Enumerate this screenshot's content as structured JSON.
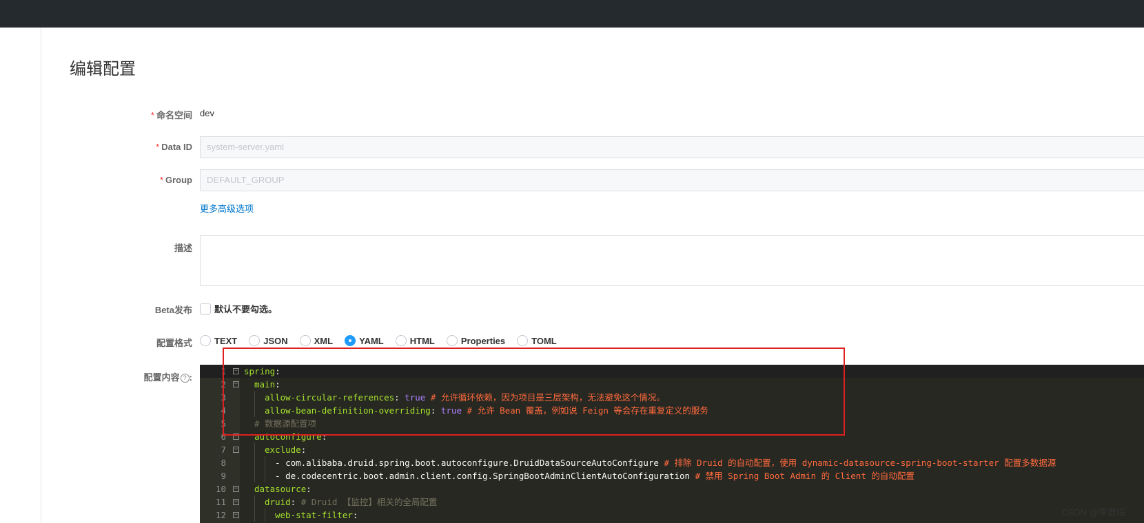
{
  "header": {
    "title": "编辑配置"
  },
  "form": {
    "namespace": {
      "label": "命名空间",
      "value": "dev"
    },
    "dataId": {
      "label": "Data ID",
      "placeholder": "system-server.yaml"
    },
    "group": {
      "label": "Group",
      "placeholder": "DEFAULT_GROUP"
    },
    "more_options": "更多高级选项",
    "desc": {
      "label": "描述"
    },
    "beta": {
      "label": "Beta发布",
      "hint": "默认不要勾选。"
    },
    "format": {
      "label": "配置格式",
      "options": [
        "TEXT",
        "JSON",
        "XML",
        "YAML",
        "HTML",
        "Properties",
        "TOML"
      ],
      "selected": "YAML"
    },
    "content": {
      "label": "配置内容",
      "help": "?",
      "colon": ":"
    }
  },
  "editor": {
    "lines": [
      {
        "num": "1",
        "fold": "⊟",
        "key": "spring",
        "sep": ":",
        "val": "",
        "comment": "",
        "cc": ""
      },
      {
        "num": "2",
        "fold": "⊟",
        "key": "main",
        "sep": ":",
        "val": "",
        "comment": "",
        "cc": ""
      },
      {
        "num": "3",
        "fold": "",
        "key": "allow-circular-references",
        "sep": ": ",
        "val": "true",
        "comment": " # 允许循环依赖，因为项目是三层架构，无法避免这个情况。",
        "cc": ""
      },
      {
        "num": "4",
        "fold": "",
        "key": "allow-bean-definition-overriding",
        "sep": ": ",
        "val": "true",
        "comment": " # 允许 Bean 覆盖，例如说 Feign 等会存在重复定义的服务",
        "cc": ""
      },
      {
        "num": "5",
        "fold": "",
        "key": "",
        "sep": "",
        "val": "",
        "comment": "",
        "cc": "# 数据源配置项"
      },
      {
        "num": "6",
        "fold": "⊟",
        "key": "autoconfigure",
        "sep": ":",
        "val": "",
        "comment": "",
        "cc": ""
      },
      {
        "num": "7",
        "fold": "⊟",
        "key": "exclude",
        "sep": ":",
        "val": "",
        "comment": "",
        "cc": ""
      },
      {
        "num": "8",
        "fold": "",
        "key": "",
        "sep": "- ",
        "val": "com.alibaba.druid.spring.boot.autoconfigure.DruidDataSourceAutoConfigure",
        "comment": " # 排除 Druid 的自动配置，使用 dynamic-datasource-spring-boot-starter 配置多数据源",
        "cc": ""
      },
      {
        "num": "9",
        "fold": "",
        "key": "",
        "sep": "- ",
        "val": "de.codecentric.boot.admin.client.config.SpringBootAdminClientAutoConfiguration",
        "comment": " # 禁用 Spring Boot Admin 的 Client 的自动配置",
        "cc": ""
      },
      {
        "num": "10",
        "fold": "⊟",
        "key": "datasource",
        "sep": ":",
        "val": "",
        "comment": "",
        "cc": ""
      },
      {
        "num": "11",
        "fold": "⊟",
        "key": "druid",
        "sep": ": ",
        "val": "",
        "comment": "",
        "cc": "# Druid 【监控】相关的全局配置"
      },
      {
        "num": "12",
        "fold": "⊟",
        "key": "web-stat-filter",
        "sep": ":",
        "val": "",
        "comment": "",
        "cc": ""
      }
    ]
  },
  "watermark": "CSDN @李君临"
}
